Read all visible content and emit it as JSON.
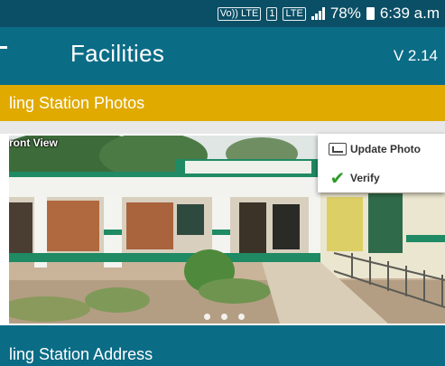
{
  "status_bar": {
    "volte_label": "Vo))\nLTE",
    "sim_label": "1",
    "lte_label": "LTE",
    "battery_percent": "78%",
    "time": "6:39 a.m"
  },
  "app_bar": {
    "title": "Facilities",
    "version": "V 2.14"
  },
  "section_photos": {
    "title": "ling Station Photos"
  },
  "photo": {
    "label": "ront View",
    "page_count": 3
  },
  "context_menu": {
    "items": [
      {
        "label": "Update Photo",
        "icon": "update-photo-icon"
      },
      {
        "label": "Verify",
        "icon": "checkmark-icon"
      }
    ]
  },
  "section_address": {
    "title": "ling Station Address"
  },
  "colors": {
    "status_bar": "#0b4f66",
    "app_bar": "#0b6c86",
    "section_header": "#e0aa00",
    "verify_check": "#2e9c2a"
  }
}
